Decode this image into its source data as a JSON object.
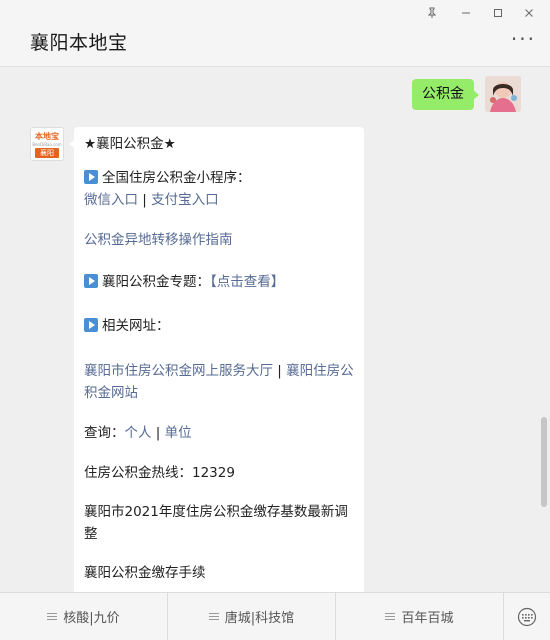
{
  "window": {
    "title": "襄阳本地宝",
    "more_label": "···"
  },
  "outgoing": {
    "text": "公积金"
  },
  "bot": {
    "avatar_brand": "本地宝",
    "avatar_domain": "BenDiBao.com",
    "avatar_city": "襄阳"
  },
  "reply": {
    "heading": "★襄阳公积金★",
    "section1": "全国住房公积金小程序：",
    "link_wechat": "微信入口",
    "sep1": " | ",
    "link_alipay": "支付宝入口",
    "link_transfer": "公积金异地转移操作指南",
    "section2": "襄阳公积金专题：",
    "link_topic": "【点击查看】",
    "section3": "相关网址：",
    "link_hall": "襄阳市住房公积金网上服务大厅",
    "sep2": " | ",
    "link_site": "襄阳住房公积金网站",
    "query_label": "查询：",
    "link_personal": "个人",
    "sep3": " | ",
    "link_company": "单位",
    "hotline": "住房公积金热线：12329",
    "base_adjust": "襄阳市2021年度住房公积金缴存基数最新调整",
    "procedure": "襄阳公积金缴存手续"
  },
  "menu": {
    "items": [
      {
        "label": "核酸|九价"
      },
      {
        "label": "唐城|科技馆"
      },
      {
        "label": "百年百城"
      }
    ]
  },
  "icons": {
    "pin": "pin-icon",
    "minimize": "minimize-icon",
    "maximize": "maximize-icon",
    "close": "close-icon",
    "keyboard": "keyboard-icon",
    "play": "play-icon",
    "menu": "menu-icon"
  },
  "colors": {
    "link": "#576b95",
    "bubble_out": "#95ec69",
    "brand": "#e4651d"
  }
}
